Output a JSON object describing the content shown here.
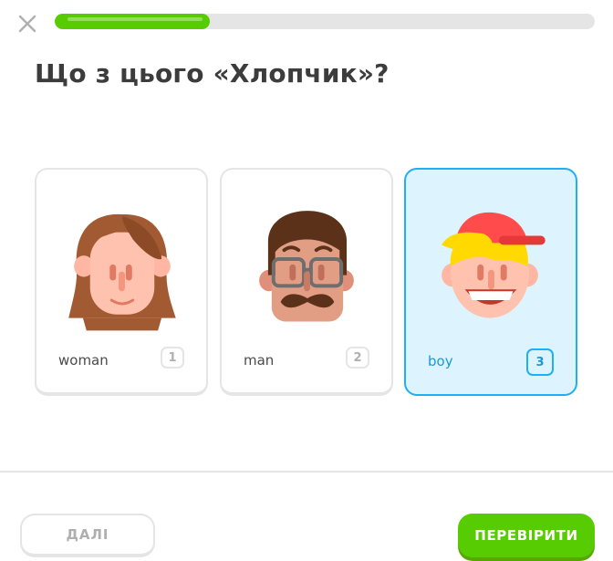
{
  "header": {
    "progress_fraction": 0.287
  },
  "question": {
    "title": "Що з цього «Хлопчик»?"
  },
  "options": [
    {
      "label": "woman",
      "key": "1",
      "icon": "woman-face-icon",
      "selected": false
    },
    {
      "label": "man",
      "key": "2",
      "icon": "man-face-icon",
      "selected": false
    },
    {
      "label": "boy",
      "key": "3",
      "icon": "boy-face-icon",
      "selected": true
    }
  ],
  "footer": {
    "skip_label": "ДАЛІ",
    "check_label": "ПЕРЕВІРИТИ"
  },
  "colors": {
    "accent_green": "#58cc02",
    "selected_blue": "#1cb0f6",
    "selected_bg": "#ddf4ff",
    "text_dark": "#3c3c3c"
  }
}
